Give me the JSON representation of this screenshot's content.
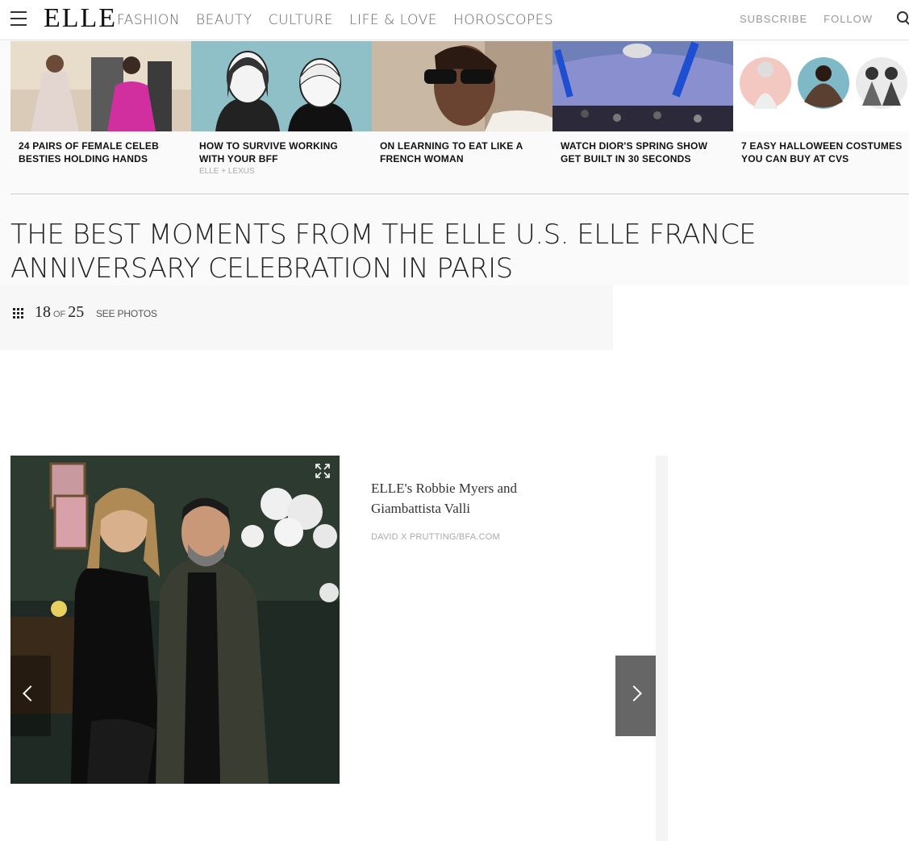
{
  "header": {
    "logo": "ELLE",
    "nav": [
      "FASHION",
      "BEAUTY",
      "CULTURE",
      "LIFE & LOVE",
      "HOROSCOPES"
    ],
    "subscribe": "SUBSCRIBE",
    "follow": "FOLLOW"
  },
  "related": [
    {
      "title": "24 PAIRS OF FEMALE CELEB BESTIES HOLDING HANDS",
      "sub": ""
    },
    {
      "title": "HOW TO SURVIVE WORKING WITH YOUR BFF",
      "sub": "ELLE + LEXUS"
    },
    {
      "title": "ON LEARNING TO EAT LIKE A FRENCH WOMAN",
      "sub": ""
    },
    {
      "title": "WATCH DIOR'S SPRING SHOW GET BUILT IN 30 SECONDS",
      "sub": ""
    },
    {
      "title": "7 EASY HALLOWEEN COSTUMES YOU CAN BUY AT CVS",
      "sub": ""
    }
  ],
  "gallery": {
    "title": "THE BEST MOMENTS FROM THE ELLE U.S. ELLE FRANCE ANNIVERSARY CELEBRATION IN PARIS",
    "current": "18",
    "of": "OF",
    "total": "25",
    "see_photos": "SEE PHOTOS"
  },
  "slide": {
    "caption": "ELLE's Robbie Myers and Giambattista Valli",
    "credit": "DAVID X PRUTTING/BFA.COM"
  }
}
